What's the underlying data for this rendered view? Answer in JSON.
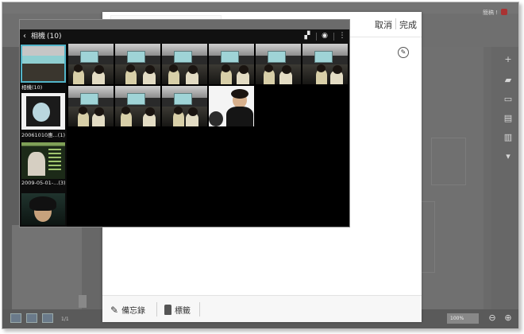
{
  "background_app": {
    "user_label": "簡稿 !",
    "page_indicator": "1/1",
    "zoom_value": "100%"
  },
  "memo": {
    "cancel_label": "取消",
    "done_label": "完成",
    "footer": {
      "memo_label": "備忘錄",
      "tag_label": "標籤"
    }
  },
  "gallery": {
    "album_title": "相機",
    "album_count": "(10)",
    "albums": [
      {
        "label": "相機(10)"
      },
      {
        "label": "20061010惠...(1)"
      },
      {
        "label": "2009-05-01-...(3)"
      },
      {
        "label": ""
      }
    ],
    "photo_count": 10
  },
  "colors": {
    "selection_accent": "#52b4c8",
    "dim_background": "#676767",
    "gallery_background": "#000000"
  }
}
